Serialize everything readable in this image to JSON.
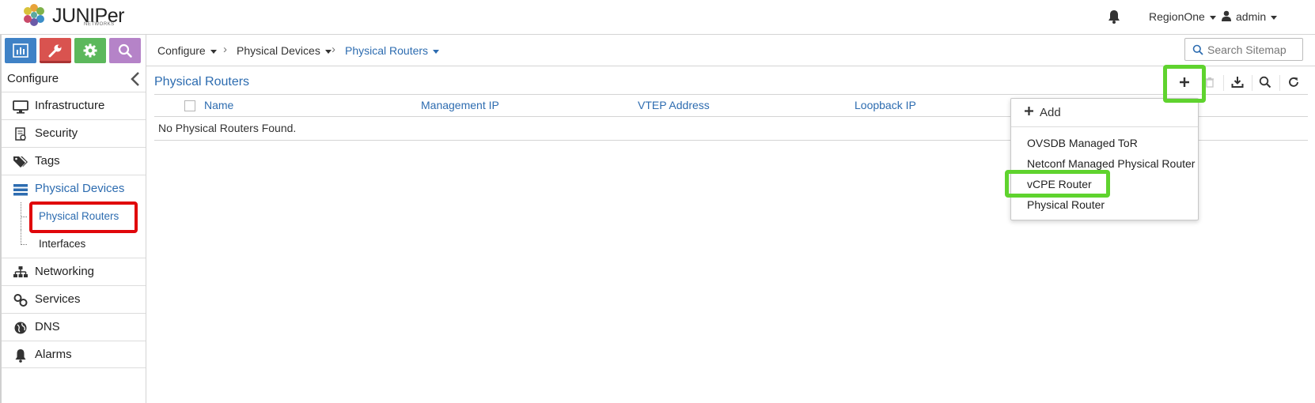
{
  "header": {
    "logo_text": "JUNIPer",
    "logo_sub": "NETWORKS",
    "region": "RegionOne",
    "user": "admin"
  },
  "sidebar": {
    "title": "Configure",
    "items": [
      {
        "label": "Infrastructure",
        "icon": "monitor-icon"
      },
      {
        "label": "Security",
        "icon": "security-doc-icon"
      },
      {
        "label": "Tags",
        "icon": "tags-icon"
      },
      {
        "label": "Physical Devices",
        "icon": "server-rack-icon"
      },
      {
        "label": "Networking",
        "icon": "network-tree-icon"
      },
      {
        "label": "Services",
        "icon": "link-icon"
      },
      {
        "label": "DNS",
        "icon": "globe-icon"
      },
      {
        "label": "Alarms",
        "icon": "bell-icon"
      }
    ],
    "sub_items": [
      {
        "label": "Physical Routers"
      },
      {
        "label": "Interfaces"
      }
    ]
  },
  "breadcrumb": [
    {
      "label": "Configure"
    },
    {
      "label": "Physical Devices"
    },
    {
      "label": "Physical Routers"
    }
  ],
  "search": {
    "placeholder": "Search Sitemap"
  },
  "content": {
    "title": "Physical Routers",
    "columns": [
      "Name",
      "Management IP",
      "VTEP Address",
      "Loopback IP"
    ],
    "empty_message": "No Physical Routers Found."
  },
  "dropdown": {
    "add_label": "Add",
    "items": [
      "OVSDB Managed ToR",
      "Netconf Managed Physical Router",
      "vCPE Router",
      "Physical Router"
    ]
  },
  "colors": {
    "accent_blue": "#2d6cb0",
    "highlight_green": "#5fd32e",
    "highlight_red": "#e0070b"
  }
}
